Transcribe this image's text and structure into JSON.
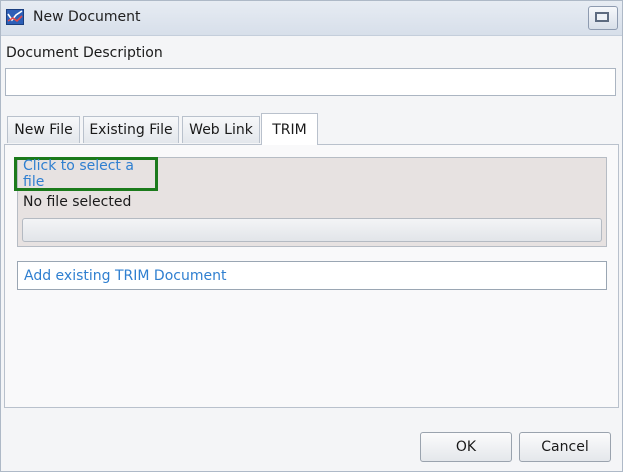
{
  "window": {
    "title": "New Document",
    "icon": "document-chart-icon"
  },
  "description": {
    "label": "Document Description",
    "value": "",
    "placeholder": ""
  },
  "tabs": [
    {
      "label": "New File",
      "active": false
    },
    {
      "label": "Existing File",
      "active": false
    },
    {
      "label": "Web Link",
      "active": false
    },
    {
      "label": "TRIM",
      "active": true
    }
  ],
  "trim_panel": {
    "select_link": "Click to select a file",
    "file_status": "No file selected",
    "upload_progress": 0,
    "existing_link": "Add existing TRIM Document"
  },
  "buttons": {
    "ok": "OK",
    "cancel": "Cancel"
  },
  "colors": {
    "link": "#2f7fd0",
    "highlight_border": "#1b7a1b"
  }
}
